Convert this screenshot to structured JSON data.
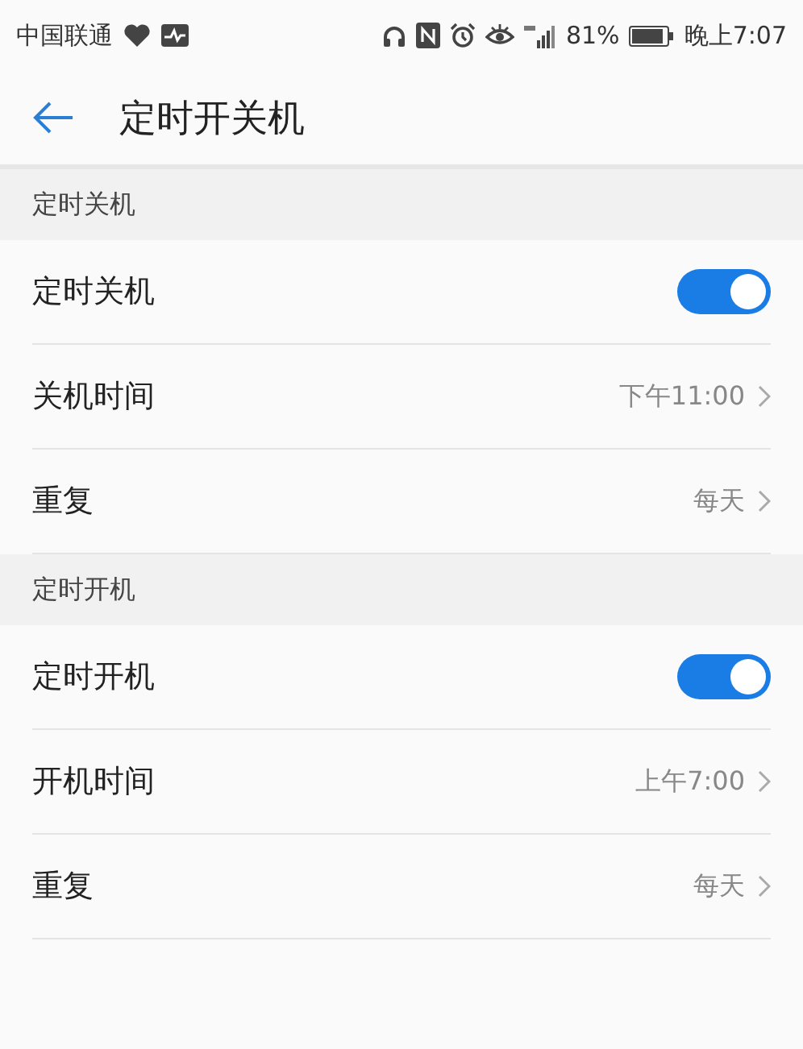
{
  "status_bar": {
    "carrier": "中国联通",
    "battery": "81%",
    "time": "晚上7:07"
  },
  "header": {
    "title": "定时开关机"
  },
  "sections": [
    {
      "title": "定时关机",
      "items": [
        {
          "kind": "toggle",
          "label": "定时关机",
          "on": true
        },
        {
          "kind": "value",
          "label": "关机时间",
          "value": "下午11:00"
        },
        {
          "kind": "value",
          "label": "重复",
          "value": "每天"
        }
      ]
    },
    {
      "title": "定时开机",
      "items": [
        {
          "kind": "toggle",
          "label": "定时开机",
          "on": true
        },
        {
          "kind": "value",
          "label": "开机时间",
          "value": "上午7:00"
        },
        {
          "kind": "value",
          "label": "重复",
          "value": "每天"
        }
      ]
    }
  ]
}
